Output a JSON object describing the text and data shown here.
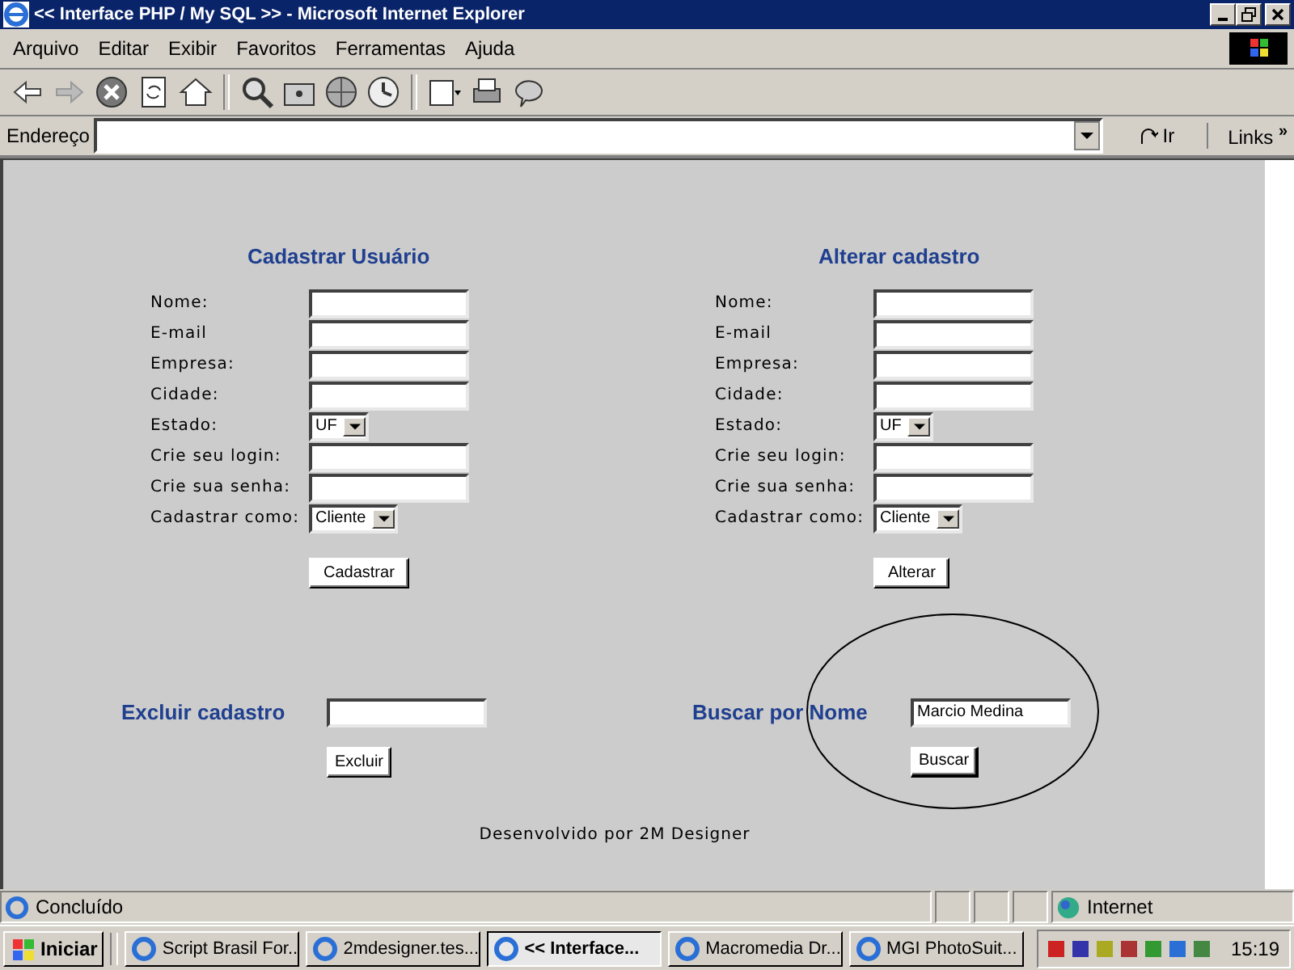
{
  "window": {
    "title": "<< Interface PHP / My SQL >> - Microsoft Internet Explorer"
  },
  "menu": [
    "Arquivo",
    "Editar",
    "Exibir",
    "Favoritos",
    "Ferramentas",
    "Ajuda"
  ],
  "address_bar": {
    "label": "Endereço",
    "go": "Ir",
    "links": "Links",
    "more": "»"
  },
  "forms": [
    {
      "title": "Cadastrar Usuário",
      "fields": [
        {
          "label": "Nome:",
          "kind": "text"
        },
        {
          "label": "E-mail",
          "kind": "text"
        },
        {
          "label": "Empresa:",
          "kind": "text"
        },
        {
          "label": "Cidade:",
          "kind": "text"
        },
        {
          "label": "Estado:",
          "kind": "select",
          "value": "UF"
        },
        {
          "label": "Crie seu login:",
          "kind": "text"
        },
        {
          "label": "Crie sua senha:",
          "kind": "text"
        },
        {
          "label": "Cadastrar como:",
          "kind": "select",
          "value": "Cliente"
        }
      ],
      "button": "Cadastrar"
    },
    {
      "title": "Alterar cadastro",
      "fields": [
        {
          "label": "Nome:",
          "kind": "text"
        },
        {
          "label": "E-mail",
          "kind": "text"
        },
        {
          "label": "Empresa:",
          "kind": "text"
        },
        {
          "label": "Cidade:",
          "kind": "text"
        },
        {
          "label": "Estado:",
          "kind": "select",
          "value": "UF"
        },
        {
          "label": "Crie seu login:",
          "kind": "text"
        },
        {
          "label": "Crie sua senha:",
          "kind": "text"
        },
        {
          "label": "Cadastrar como:",
          "kind": "select",
          "value": "Cliente"
        }
      ],
      "button": "Alterar"
    }
  ],
  "delete": {
    "title": "Excluir cadastro",
    "button": "Excluir"
  },
  "search": {
    "title": "Buscar por Nome",
    "value": "Marcio Medina",
    "button": "Buscar",
    "circled": true
  },
  "footer": "Desenvolvido por 2M Designer",
  "status_bar": {
    "text": "Concluído",
    "zone": "Internet"
  },
  "taskbar": {
    "start": "Iniciar",
    "tasks": [
      {
        "label": "Script Brasil For...",
        "selected": false
      },
      {
        "label": "2mdesigner.tes...",
        "selected": false
      },
      {
        "label": "<< Interface...",
        "selected": true
      },
      {
        "label": "Macromedia Dr...",
        "selected": false
      },
      {
        "label": "MGI PhotoSuit...",
        "selected": false
      }
    ],
    "clock": "15:19"
  }
}
